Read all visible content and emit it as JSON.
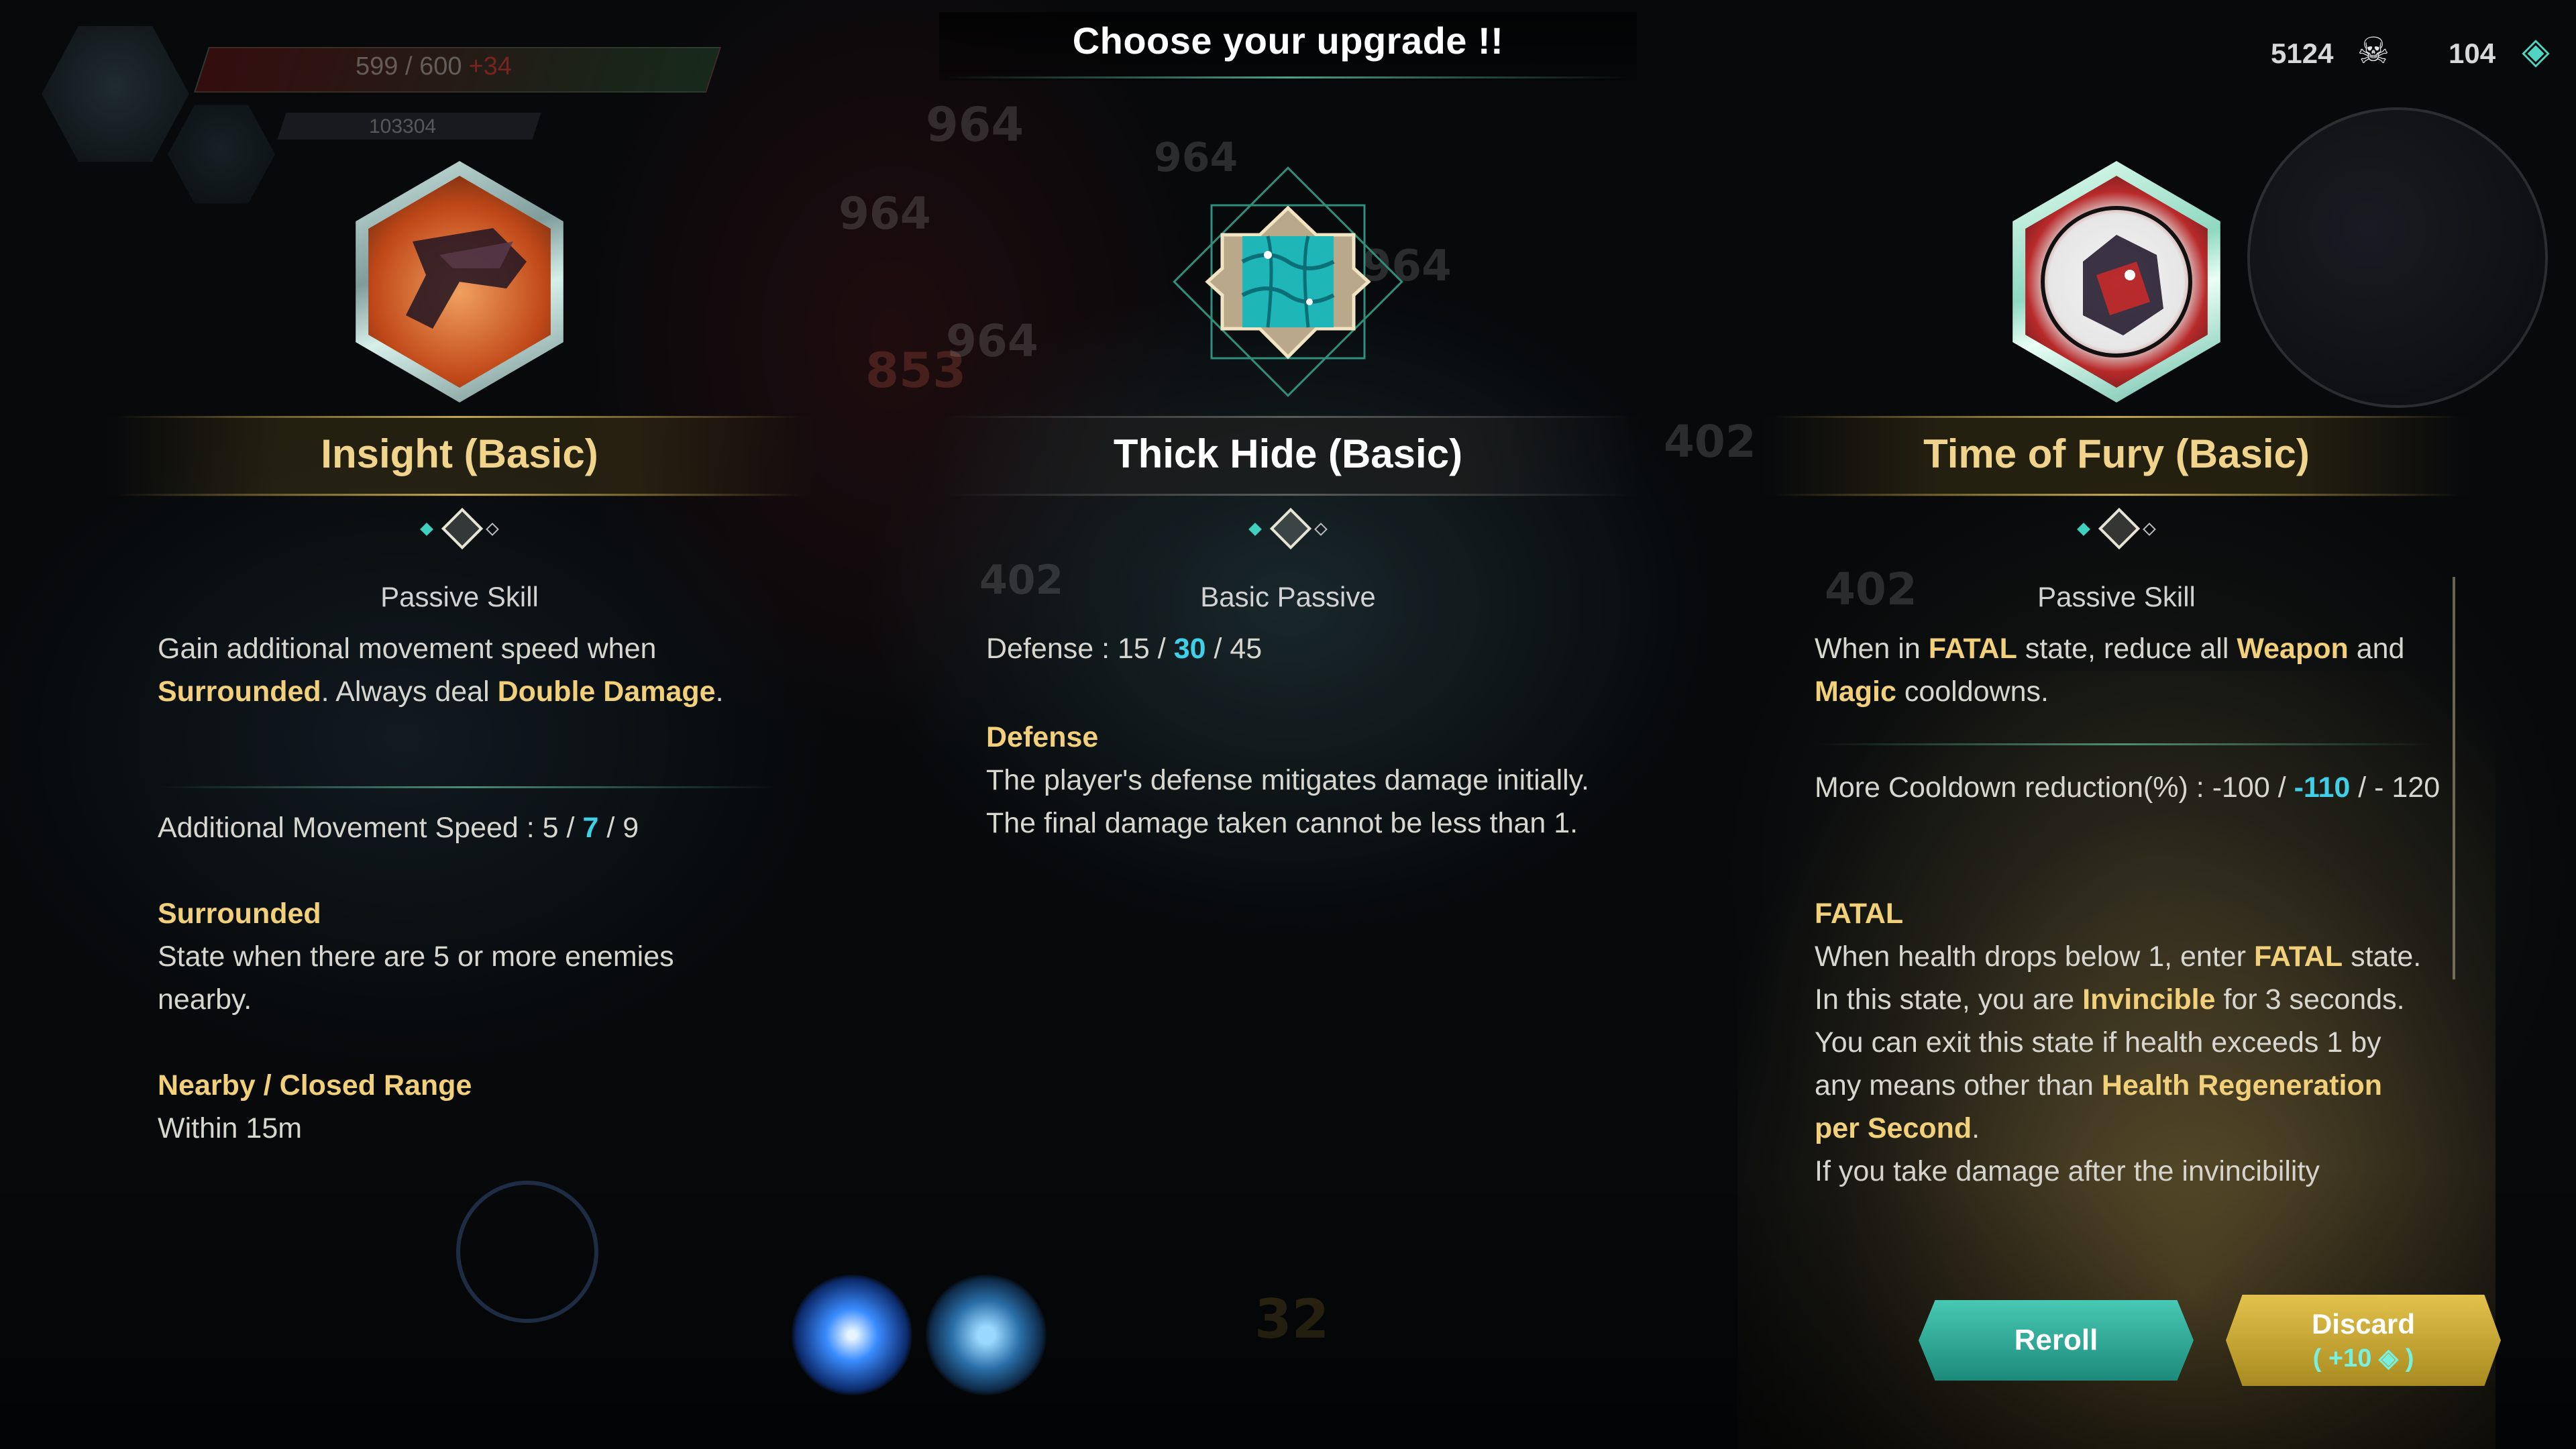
{
  "header": {
    "title": "Choose your upgrade !!",
    "hp_text": "599 / 600",
    "hp_regen": "+34",
    "xp_text": "103304"
  },
  "counters": {
    "kills": "5124",
    "kills_icon": "skull-icon",
    "currency": "104",
    "currency_icon": "soul-gem-icon"
  },
  "cards": [
    {
      "name": "Insight (Basic)",
      "type": "Passive Skill",
      "icon": "insight-skill-icon",
      "desc_1a": "Gain additional movement speed when",
      "desc_1b_kw": "Surrounded",
      "desc_1c": ". Always deal",
      "desc_1d_kw": "Double",
      "desc_1e_kw": "Damage",
      "desc_1f": ".",
      "stat_label": "Additional Movement Speed : 5 /",
      "stat_hl": "7",
      "stat_end": "/ 9",
      "kw1_title": "Surrounded",
      "kw1_text": "State when there are 5 or more enemies nearby.",
      "kw2_title": "Nearby / Closed Range",
      "kw2_text": "Within 15m"
    },
    {
      "name": "Thick Hide (Basic)",
      "type": "Basic Passive",
      "icon": "thick-hide-skill-icon",
      "stat_label": "Defense : 15 /",
      "stat_hl": "30",
      "stat_end": "/ 45",
      "kw1_title": "Defense",
      "kw1_text": "The player's defense mitigates damage initially. The final damage taken cannot be less than 1."
    },
    {
      "name": "Time of Fury (Basic)",
      "type": "Passive Skill",
      "icon": "time-of-fury-skill-icon",
      "desc_a": "When in",
      "desc_b_kw": "FATAL",
      "desc_c": "state, reduce all",
      "desc_d_kw": "Weapon",
      "desc_e": "and",
      "desc_f_kw": "Magic",
      "desc_g": "cooldowns.",
      "stat_label": "More Cooldown reduction(%) : -100 /",
      "stat_hl": "-110",
      "stat_end": "/ - 120",
      "kw1_title": "FATAL",
      "kw1_a": "When health drops below 1, enter",
      "kw1_b_kw": "FATAL",
      "kw1_c": "state.",
      "kw1_d": "In this state, you are",
      "kw1_e_kw": "Invincible",
      "kw1_f": "for 3 seconds. You can exit this state if health exceeds 1 by any means other than",
      "kw1_g_kw": "Health Regeneration per Second",
      "kw1_h": ".",
      "kw1_cut": "If you take damage after the invincibility"
    }
  ],
  "buttons": {
    "reroll": "Reroll",
    "discard": "Discard",
    "discard_reward": "( +10",
    "discard_reward_end": ")",
    "discard_icon": "soul-gem-icon"
  },
  "ghost_numbers": [
    "964",
    "964",
    "964",
    "853",
    "964",
    "964",
    "402",
    "402",
    "402",
    "32"
  ],
  "colors": {
    "accent_gold": "#f2d07a",
    "accent_cyan": "#3fd0e8",
    "reroll": "#2fae9b",
    "discard": "#d4b23a"
  }
}
